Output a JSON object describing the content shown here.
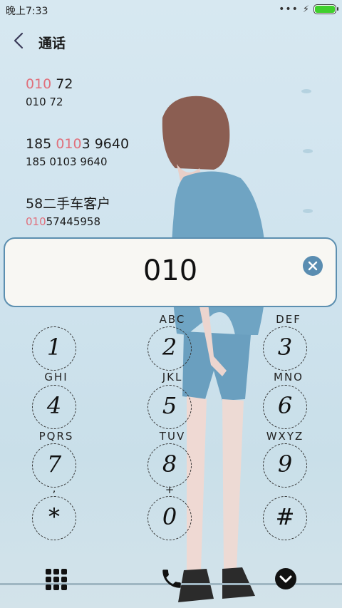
{
  "status": {
    "time": "晚上7:33",
    "battery_level": 1.0
  },
  "header": {
    "title": "通话"
  },
  "results": [
    {
      "name_hl": "010",
      "name_rest": " 72",
      "num_pre": "",
      "num_hl": "",
      "num_post": "010 72"
    },
    {
      "name_pre": "185 ",
      "name_hl": "010",
      "name_rest": "3 9640",
      "num_pre": "",
      "num_hl": "",
      "num_post": "185 0103 9640"
    },
    {
      "name_pre": "58二手车客户",
      "name_hl": "",
      "name_rest": "",
      "num_pre": "",
      "num_hl": "010",
      "num_post": "57445958"
    }
  ],
  "input": {
    "value": "010"
  },
  "keys": [
    {
      "digit": "1",
      "letters": ""
    },
    {
      "digit": "2",
      "letters": "ABC"
    },
    {
      "digit": "3",
      "letters": "DEF"
    },
    {
      "digit": "4",
      "letters": "GHI"
    },
    {
      "digit": "5",
      "letters": "JKL"
    },
    {
      "digit": "6",
      "letters": "MNO"
    },
    {
      "digit": "7",
      "letters": "PQRS"
    },
    {
      "digit": "8",
      "letters": "TUV"
    },
    {
      "digit": "9",
      "letters": "WXYZ"
    },
    {
      "digit": "*",
      "letters": ","
    },
    {
      "digit": "0",
      "letters": "+"
    },
    {
      "digit": "#",
      "letters": ""
    }
  ],
  "icons": {
    "keypad": "keypad-grid-icon",
    "call": "phone-icon",
    "collapse": "chevron-down-circle-icon",
    "back": "chevron-left-icon",
    "clear": "clear-x-icon"
  },
  "colors": {
    "highlight": "#e0707c",
    "accent": "#5a8db1",
    "battery": "#3fcf2e"
  }
}
